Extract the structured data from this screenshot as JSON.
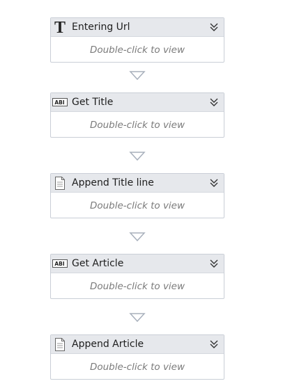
{
  "workflow": {
    "activities": [
      {
        "title": "Entering Url",
        "hint": "Double-click to view",
        "icon": "text-t-icon"
      },
      {
        "title": "Get Title",
        "hint": "Double-click to view",
        "icon": "get-text-icon"
      },
      {
        "title": "Append Title line",
        "hint": "Double-click to view",
        "icon": "document-icon"
      },
      {
        "title": "Get Article",
        "hint": "Double-click to view",
        "icon": "get-text-icon"
      },
      {
        "title": "Append Article",
        "hint": "Double-click to view",
        "icon": "document-icon"
      }
    ],
    "icon_badge_text": "ABI",
    "colors": {
      "header_bg": "#e6e8ec",
      "border": "#c9ced6",
      "hint_text": "#7a7a7a",
      "connector": "#a8b0bc"
    }
  }
}
